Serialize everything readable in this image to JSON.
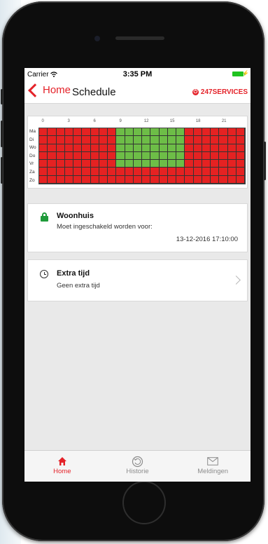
{
  "status": {
    "carrier": "Carrier",
    "time": "3:35 PM"
  },
  "nav": {
    "back_label": "Home",
    "title": "Schedule",
    "brand": "247SERVICES"
  },
  "colors": {
    "accent": "#e42229",
    "enabled": "#6dbd47",
    "disabled": "#e52222",
    "lock": "#1f9b3a"
  },
  "schedule": {
    "hour_labels": [
      "0",
      "3",
      "6",
      "9",
      "12",
      "15",
      "18",
      "21"
    ],
    "days": [
      "Ma",
      "Di",
      "Wo",
      "Do",
      "Vr",
      "Za",
      "Zo"
    ],
    "slots_per_day": 24,
    "rows": [
      [
        0,
        0,
        0,
        0,
        0,
        0,
        0,
        0,
        0,
        1,
        1,
        1,
        1,
        1,
        1,
        1,
        1,
        0,
        0,
        0,
        0,
        0,
        0,
        0
      ],
      [
        0,
        0,
        0,
        0,
        0,
        0,
        0,
        0,
        0,
        1,
        1,
        1,
        1,
        1,
        1,
        1,
        1,
        0,
        0,
        0,
        0,
        0,
        0,
        0
      ],
      [
        0,
        0,
        0,
        0,
        0,
        0,
        0,
        0,
        0,
        1,
        1,
        1,
        1,
        1,
        1,
        1,
        1,
        0,
        0,
        0,
        0,
        0,
        0,
        0
      ],
      [
        0,
        0,
        0,
        0,
        0,
        0,
        0,
        0,
        0,
        1,
        1,
        1,
        1,
        1,
        1,
        1,
        1,
        0,
        0,
        0,
        0,
        0,
        0,
        0
      ],
      [
        0,
        0,
        0,
        0,
        0,
        0,
        0,
        0,
        0,
        1,
        1,
        1,
        1,
        1,
        1,
        1,
        1,
        0,
        0,
        0,
        0,
        0,
        0,
        0
      ],
      [
        0,
        0,
        0,
        0,
        0,
        0,
        0,
        0,
        0,
        0,
        0,
        0,
        0,
        0,
        0,
        0,
        0,
        0,
        0,
        0,
        0,
        0,
        0,
        0
      ],
      [
        0,
        0,
        0,
        0,
        0,
        0,
        0,
        0,
        0,
        0,
        0,
        0,
        0,
        0,
        0,
        0,
        0,
        0,
        0,
        0,
        0,
        0,
        0,
        0
      ]
    ]
  },
  "location": {
    "icon": "lock-icon",
    "title": "Woonhuis",
    "subtitle": "Moet ingeschakeld worden voor:",
    "deadline": "13-12-2016 17:10:00"
  },
  "extra_time": {
    "icon": "clock-icon",
    "title": "Extra tijd",
    "subtitle": "Geen extra tijd"
  },
  "tabs": [
    {
      "label": "Home",
      "icon": "home-icon",
      "active": true
    },
    {
      "label": "Historie",
      "icon": "history-icon",
      "active": false
    },
    {
      "label": "Meldingen",
      "icon": "mail-icon",
      "active": false
    }
  ]
}
